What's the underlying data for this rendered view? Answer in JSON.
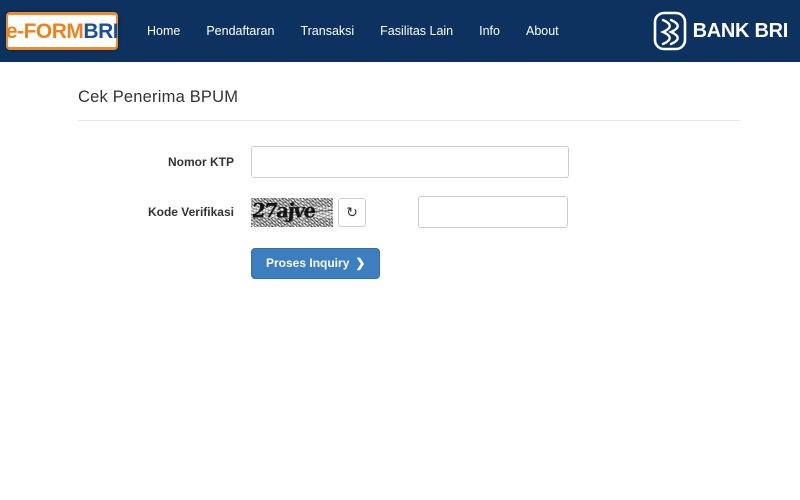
{
  "header": {
    "logo": {
      "part1": "e-FORM",
      "part2": "BRI",
      "part1_color": "#f0821e",
      "part2_color": "#1a4fa0"
    },
    "bank_logo": {
      "name": "bri-mark-icon",
      "text": "BANK BRI"
    },
    "background_color": "#0d325f",
    "nav": [
      {
        "label": "Home"
      },
      {
        "label": "Pendaftaran"
      },
      {
        "label": "Transaksi"
      },
      {
        "label": "Fasilitas Lain"
      },
      {
        "label": "Info"
      },
      {
        "label": "About"
      }
    ]
  },
  "main": {
    "title": "Cek Penerima BPUM",
    "form": {
      "ktp": {
        "label": "Nomor KTP",
        "value": "",
        "placeholder": ""
      },
      "captcha": {
        "label": "Kode Verifikasi",
        "image_text": "27ajve",
        "refresh_icon": "refresh-icon",
        "refresh_glyph": "↻",
        "value": "",
        "placeholder": ""
      },
      "submit": {
        "label": "Proses Inquiry",
        "chevron": "❯",
        "color": "#3c7ebf"
      }
    }
  }
}
